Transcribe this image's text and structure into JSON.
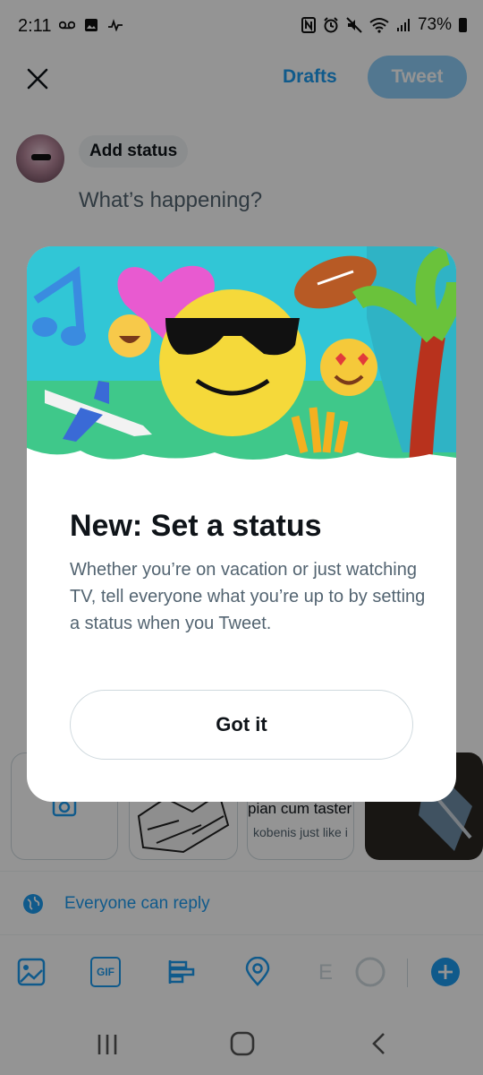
{
  "status_bar": {
    "time": "2:11",
    "battery": "73%"
  },
  "header": {
    "drafts_label": "Drafts",
    "tweet_label": "Tweet"
  },
  "composer": {
    "add_status_label": "Add status",
    "placeholder": "What’s happening?"
  },
  "media_cards": [
    {
      "line1": "pian cum taster",
      "line2": "kobenis just like i"
    }
  ],
  "reply_setting": "Everyone can reply",
  "toolbar": {
    "gif_label": "GIF",
    "char_fragment": "E"
  },
  "dialog": {
    "title": "New: Set a status",
    "body": "Whether you’re on vacation or just watching TV, tell everyone what you’re up to by setting a status when you Tweet.",
    "button": "Got it"
  },
  "colors": {
    "accent": "#1d9bf0",
    "tweet_button_disabled": "#8ecdf8",
    "overlay": "rgba(0,0,0,0.42)"
  }
}
